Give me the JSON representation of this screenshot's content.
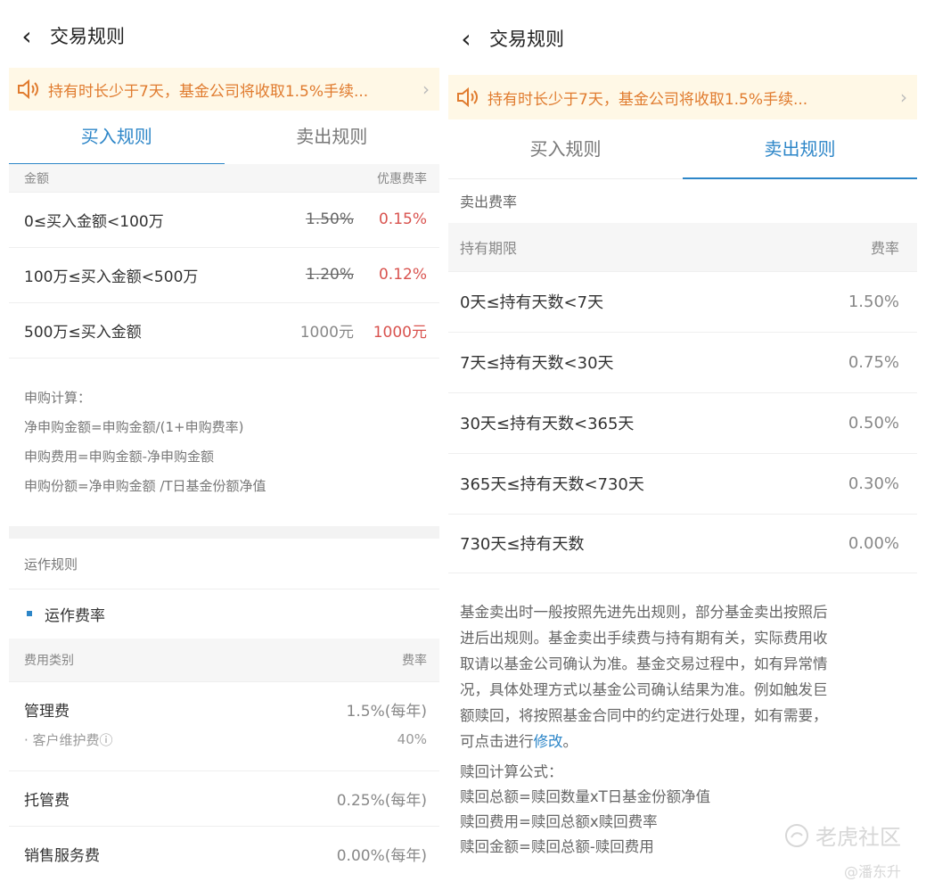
{
  "left": {
    "title": "交易规则",
    "notice": "持有时长少于7天，基金公司将收取1.5%手续...",
    "tabs": [
      "买入规则",
      "卖出规则"
    ],
    "active_tab": "买入规则",
    "fee_table": {
      "headers": [
        "金额",
        "优惠费率"
      ],
      "rows": [
        {
          "range": "0≤买入金额<100万",
          "original": "1.50%",
          "discount": "0.15%"
        },
        {
          "range": "100万≤买入金额<500万",
          "original": "1.20%",
          "discount": "0.12%"
        },
        {
          "range": "500万≤买入金额",
          "original": "1000元",
          "discount": "1000元"
        }
      ]
    },
    "calc": {
      "title": "申购计算：",
      "lines": [
        "净申购金额=申购金额/(1+申购费率)",
        "申购费用=申购金额-净申购金额",
        "申购份额=净申购金额 /T日基金份额净值"
      ]
    },
    "ops": {
      "section_title": "运作规则",
      "subsection": "运作费率",
      "headers": [
        "费用类别",
        "费率"
      ],
      "rows": [
        {
          "name": "管理费",
          "rate": "1.5%(每年)"
        },
        {
          "name": "· 客户维护费ⓘ",
          "rate": "40%"
        },
        {
          "name": "托管费",
          "rate": "0.25%(每年)"
        },
        {
          "name": "销售服务费",
          "rate": "0.00%(每年)"
        }
      ]
    }
  },
  "right": {
    "title": "交易规则",
    "notice": "持有时长少于7天，基金公司将收取1.5%手续...",
    "tabs": [
      "买入规则",
      "卖出规则"
    ],
    "active_tab": "卖出规则",
    "sell_title": "卖出费率",
    "headers": [
      "持有期限",
      "费率"
    ],
    "rows": [
      {
        "period": "0天≤持有天数<7天",
        "rate": "1.50%"
      },
      {
        "period": "7天≤持有天数<30天",
        "rate": "0.75%"
      },
      {
        "period": "30天≤持有天数<365天",
        "rate": "0.50%"
      },
      {
        "period": "365天≤持有天数<730天",
        "rate": "0.30%"
      },
      {
        "period": "730天≤持有天数",
        "rate": "0.00%"
      }
    ],
    "paragraph_lines": [
      "基金卖出时一般按照先进先出规则，部分基金卖出按照后",
      "进后出规则。基金卖出手续费与持有期有关，实际费用收",
      "取请以基金公司确认为准。基金交易过程中，如有异常情",
      "况，具体处理方式以基金公司确认结果为准。例如触发巨",
      "额赎回，将按照基金合同中的约定进行处理，如有需要，"
    ],
    "paragraph_last_prefix": "可点击进行",
    "modify_link": "修改",
    "paragraph_last_suffix": "。",
    "formula_title": "赎回计算公式：",
    "formula_lines": [
      "赎回总额=赎回数量xT日基金份额净值",
      "赎回费用=赎回总额x赎回费率",
      "赎回金额=赎回总额-赎回费用"
    ]
  },
  "watermark": {
    "brand": "老虎社区",
    "user": "@潘东升"
  },
  "colors": {
    "accent": "#2d86c8",
    "discount": "#d9534f",
    "notice": "#e07b2e",
    "notice_bg": "#fff8e6"
  }
}
